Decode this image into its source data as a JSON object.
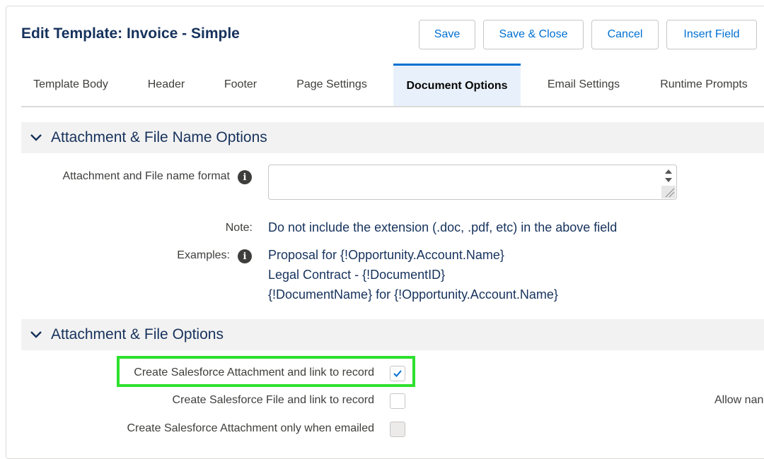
{
  "header": {
    "title": "Edit Template: Invoice - Simple",
    "buttons": {
      "save": "Save",
      "save_close": "Save & Close",
      "cancel": "Cancel",
      "insert_field": "Insert Field"
    }
  },
  "tabs": [
    {
      "label": "Template Body",
      "active": false
    },
    {
      "label": "Header",
      "active": false
    },
    {
      "label": "Footer",
      "active": false
    },
    {
      "label": "Page Settings",
      "active": false
    },
    {
      "label": "Document Options",
      "active": true
    },
    {
      "label": "Email Settings",
      "active": false
    },
    {
      "label": "Runtime Prompts",
      "active": false
    }
  ],
  "section_file_name": {
    "title": "Attachment & File Name Options",
    "format_label": "Attachment and File name format",
    "format_value": "",
    "note_label": "Note:",
    "note_text": "Do not include the extension (.doc, .pdf, etc) in the above field",
    "examples_label": "Examples:",
    "examples": [
      "Proposal for {!Opportunity.Account.Name}",
      "Legal Contract - {!DocumentID}",
      "{!DocumentName} for {!Opportunity.Account.Name}"
    ]
  },
  "section_file_options": {
    "title": "Attachment & File Options",
    "options": [
      {
        "label": "Create Salesforce Attachment and link to record",
        "checked": true,
        "disabled": false
      },
      {
        "label": "Create Salesforce File and link to record",
        "checked": false,
        "disabled": false
      },
      {
        "label": "Create Salesforce Attachment only when emailed",
        "checked": false,
        "disabled": true
      }
    ],
    "right_partial_label": "Allow nan"
  },
  "icons": {
    "info": "info-icon",
    "collapse": "chevron-down-icon",
    "check": "checkmark-icon"
  },
  "colors": {
    "brand": "#0070d2",
    "title": "#16325c",
    "highlight": "#2ee02e",
    "active_tab_bg": "#e8f1fb"
  }
}
